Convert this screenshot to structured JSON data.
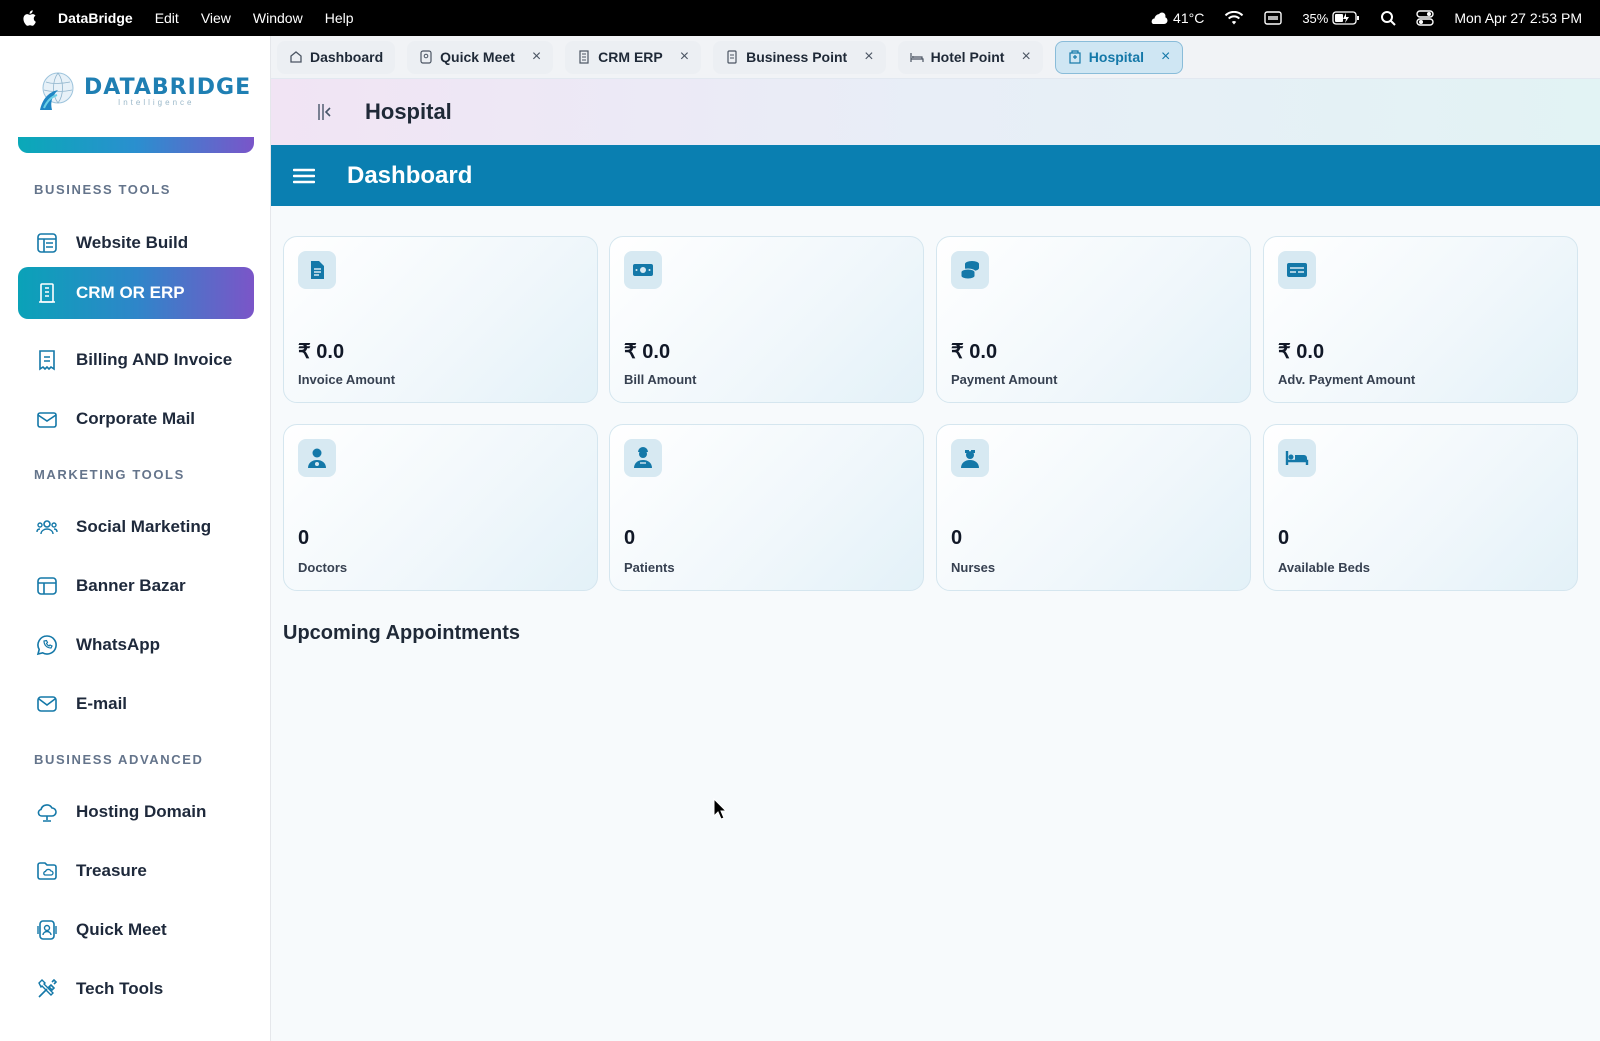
{
  "menubar": {
    "app_name": "DataBridge",
    "menus": [
      "Edit",
      "View",
      "Window",
      "Help"
    ],
    "weather": "41°C",
    "battery": "35%",
    "datetime": "Mon Apr 27  2:53 PM"
  },
  "sidebar": {
    "logo_brand": "DATABRIDGE",
    "logo_tagline": "Intelligence",
    "sections": [
      {
        "title": "BUSINESS TOOLS"
      },
      {
        "title": "MARKETING TOOLS"
      },
      {
        "title": "BUSINESS ADVANCED"
      }
    ],
    "items": [
      {
        "label": "Website Build",
        "icon": "layout-icon"
      },
      {
        "label": "CRM OR ERP",
        "icon": "building-icon",
        "active": true
      },
      {
        "label": "Billing AND  Invoice",
        "icon": "receipt-icon"
      },
      {
        "label": "Corporate Mail",
        "icon": "mail-open-icon"
      },
      {
        "label": "Social Marketing",
        "icon": "users-icon"
      },
      {
        "label": "Banner Bazar",
        "icon": "banner-icon"
      },
      {
        "label": "WhatsApp",
        "icon": "whatsapp-icon"
      },
      {
        "label": "E-mail",
        "icon": "envelope-icon"
      },
      {
        "label": "Hosting Domain",
        "icon": "cloud-icon"
      },
      {
        "label": "Treasure",
        "icon": "folder-cloud-icon"
      },
      {
        "label": "Quick Meet",
        "icon": "meet-icon"
      },
      {
        "label": "Tech Tools",
        "icon": "tools-icon"
      }
    ]
  },
  "tabs": [
    {
      "label": "Dashboard",
      "closable": false
    },
    {
      "label": "Quick Meet",
      "closable": true
    },
    {
      "label": "CRM ERP",
      "closable": true
    },
    {
      "label": "Business Point",
      "closable": true
    },
    {
      "label": "Hotel Point",
      "closable": true
    },
    {
      "label": "Hospital",
      "closable": true,
      "active": true
    }
  ],
  "tab_close_glyph": "×",
  "page_header": {
    "title": "Hospital"
  },
  "dashboard_bar": {
    "title": "Dashboard"
  },
  "cards": [
    {
      "value": "₹ 0.0",
      "label": "Invoice Amount",
      "icon": "document-icon"
    },
    {
      "value": "₹ 0.0",
      "label": "Bill Amount",
      "icon": "cash-icon"
    },
    {
      "value": "₹ 0.0",
      "label": "Payment Amount",
      "icon": "coins-icon"
    },
    {
      "value": "₹ 0.0",
      "label": "Adv. Payment Amount",
      "icon": "card-icon"
    },
    {
      "value": "0",
      "label": "Doctors",
      "icon": "doctor-icon"
    },
    {
      "value": "0",
      "label": "Patients",
      "icon": "patient-icon"
    },
    {
      "value": "0",
      "label": "Nurses",
      "icon": "nurse-icon"
    },
    {
      "value": "0",
      "label": "Available Beds",
      "icon": "bed-icon"
    }
  ],
  "appointments_heading": "Upcoming Appointments",
  "colors": {
    "accent_blue": "#0a7fb1",
    "active_gradient_start": "#0aa2b8",
    "active_gradient_end": "#7b55c8",
    "icon_blue": "#1478a8"
  }
}
